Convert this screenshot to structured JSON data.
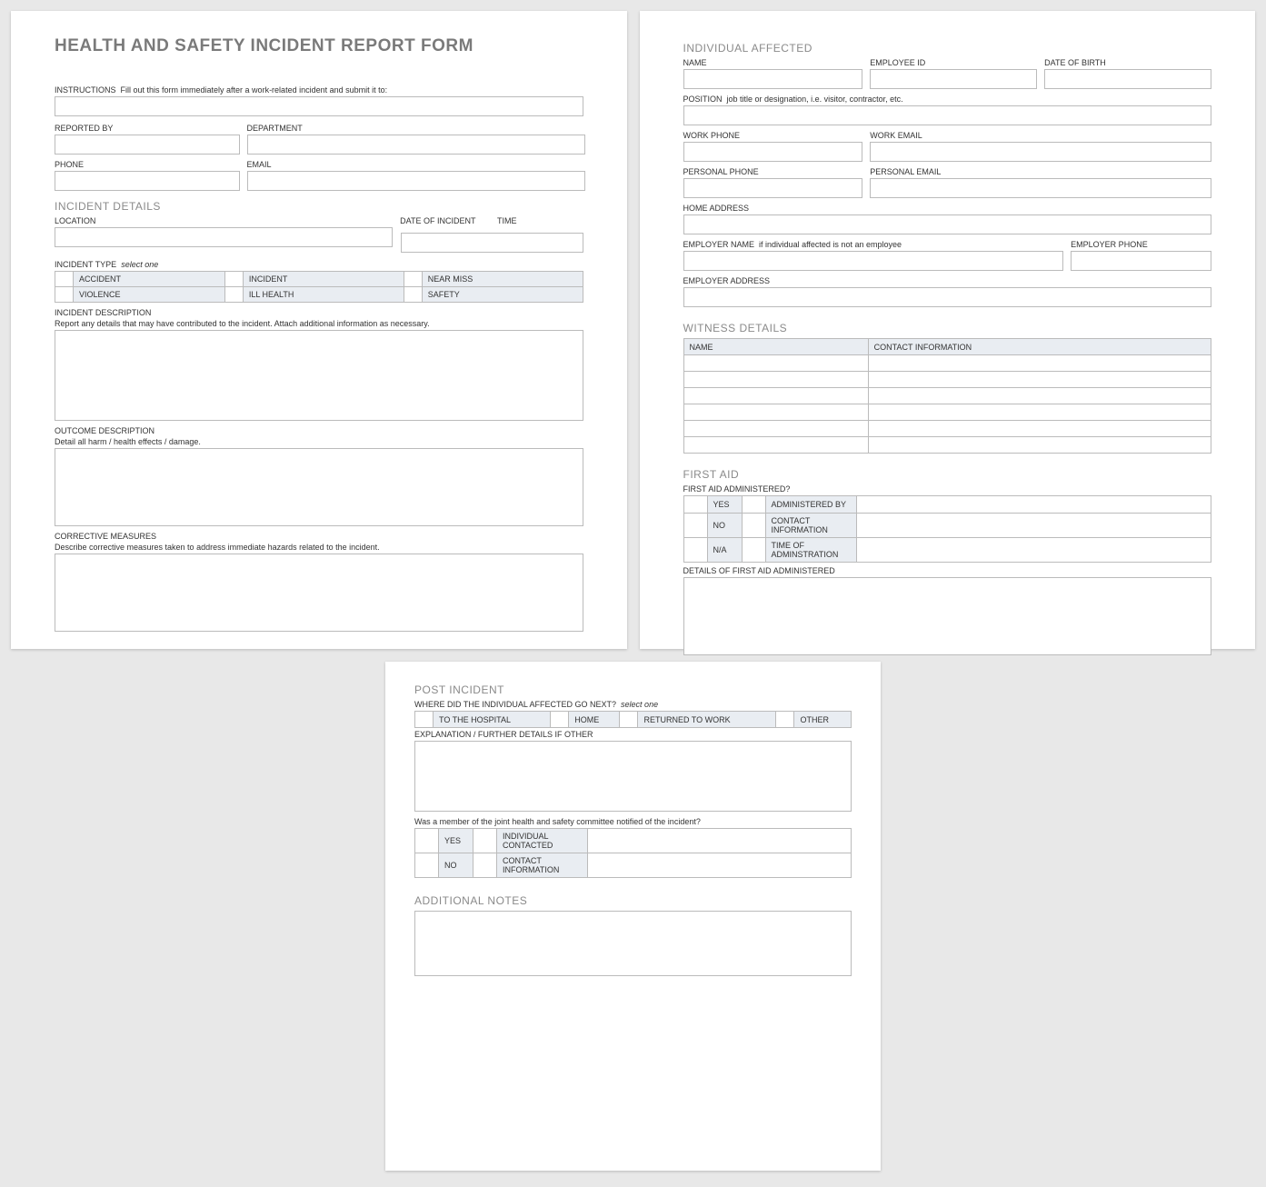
{
  "page1": {
    "title": "HEALTH AND SAFETY INCIDENT REPORT FORM",
    "instructions_label": "INSTRUCTIONS",
    "instructions_text": "Fill out this form immediately after a work-related incident and submit it to:",
    "reported_by": "REPORTED BY",
    "department": "DEPARTMENT",
    "phone": "PHONE",
    "email": "EMAIL",
    "incident_details": "INCIDENT DETAILS",
    "location": "LOCATION",
    "date_of_incident": "DATE OF INCIDENT",
    "time": "TIME",
    "incident_type": "INCIDENT TYPE",
    "select_one": "select one",
    "types": [
      "ACCIDENT",
      "INCIDENT",
      "NEAR MISS",
      "VIOLENCE",
      "ILL HEALTH",
      "SAFETY"
    ],
    "incident_desc": "INCIDENT DESCRIPTION",
    "incident_desc2": "Report any details that may have contributed to the incident.  Attach additional information as necessary.",
    "outcome_desc": "OUTCOME DESCRIPTION",
    "outcome_desc2": "Detail all harm / health effects / damage.",
    "corrective": "CORRECTIVE MEASURES",
    "corrective2": "Describe corrective measures taken to address immediate hazards related to the incident."
  },
  "page2": {
    "individual_affected": "INDIVIDUAL AFFECTED",
    "name": "NAME",
    "employee_id": "EMPLOYEE ID",
    "dob": "DATE OF BIRTH",
    "position": "POSITION",
    "position_hint": "job title or designation, i.e. visitor, contractor, etc.",
    "work_phone": "WORK PHONE",
    "work_email": "WORK EMAIL",
    "personal_phone": "PERSONAL PHONE",
    "personal_email": "PERSONAL EMAIL",
    "home_address": "HOME ADDRESS",
    "employer_name": "EMPLOYER NAME",
    "employer_name_hint": "if individual affected is not an employee",
    "employer_phone": "EMPLOYER PHONE",
    "employer_address": "EMPLOYER ADDRESS",
    "witness_details": "WITNESS DETAILS",
    "witness_name": "NAME",
    "witness_contact": "CONTACT INFORMATION",
    "first_aid": "FIRST AID",
    "first_aid_q": "FIRST AID ADMINISTERED?",
    "yes": "YES",
    "no": "NO",
    "na": "N/A",
    "administered_by": "ADMINISTERED BY",
    "contact_info": "CONTACT INFORMATION",
    "time_admin": "TIME OF ADMINSTRATION",
    "details_fa": "DETAILS OF FIRST AID ADMINISTERED"
  },
  "page3": {
    "post_incident": "POST INCIDENT",
    "where_q": "WHERE DID THE INDIVIDUAL AFFECTED GO NEXT?",
    "select_one": "select one",
    "opts": [
      "TO THE HOSPITAL",
      "HOME",
      "RETURNED TO WORK",
      "OTHER"
    ],
    "explanation": "EXPLANATION / FURTHER DETAILS IF OTHER",
    "committee_q": "Was a member of the joint health and safety committee notified of the incident?",
    "yes": "YES",
    "no": "NO",
    "individual_contacted": "INDIVIDUAL CONTACTED",
    "contact_info": "CONTACT INFORMATION",
    "additional_notes": "ADDITIONAL NOTES"
  }
}
